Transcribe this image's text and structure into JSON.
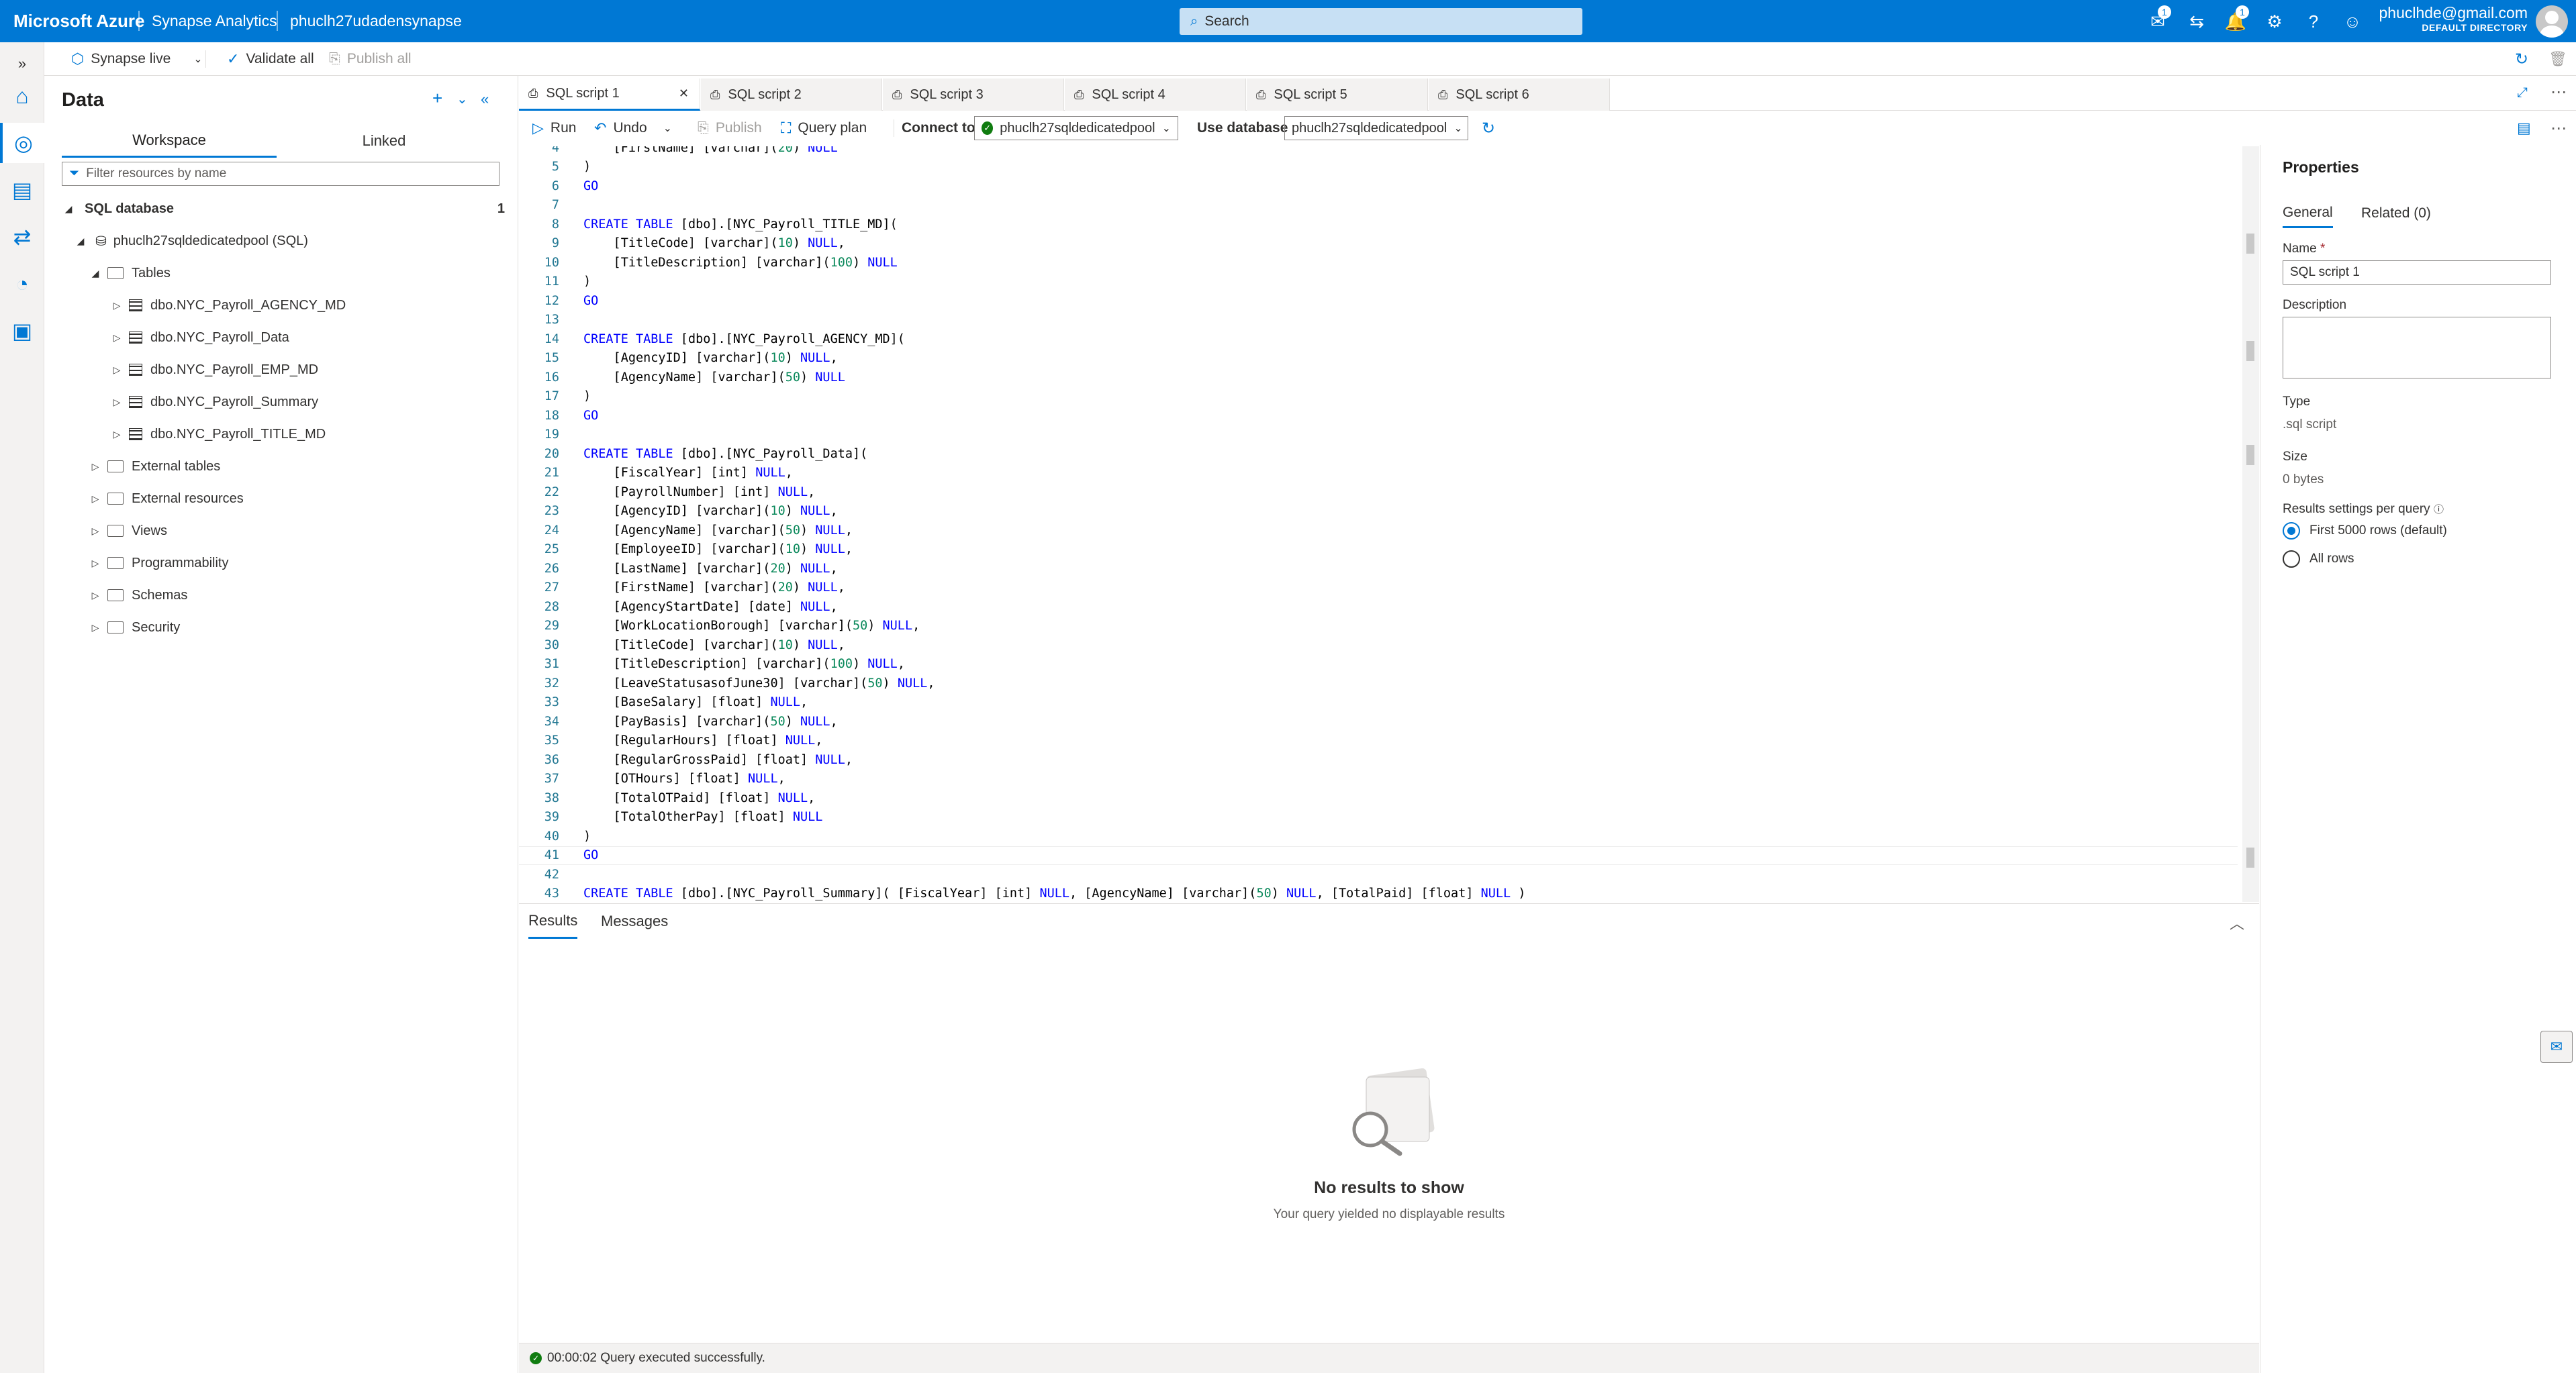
{
  "topbar": {
    "brand": "Microsoft Azure",
    "service": "Synapse Analytics",
    "workspace": "phuclh27udadensynapse",
    "search_placeholder": "Search",
    "badge_feedback": "1",
    "badge_notifications": "1",
    "user_email": "phuclhde@gmail.com",
    "directory": "DEFAULT DIRECTORY"
  },
  "commandbar": {
    "live_mode": "Synapse live",
    "validate_all": "Validate all",
    "publish_all": "Publish all"
  },
  "data_panel": {
    "title": "Data",
    "tab_workspace": "Workspace",
    "tab_linked": "Linked",
    "filter_placeholder": "Filter resources by name",
    "section": "SQL database",
    "section_count": "1",
    "pool": "phuclh27sqldedicatedpool (SQL)",
    "tables_label": "Tables",
    "tables": [
      "dbo.NYC_Payroll_AGENCY_MD",
      "dbo.NYC_Payroll_Data",
      "dbo.NYC_Payroll_EMP_MD",
      "dbo.NYC_Payroll_Summary",
      "dbo.NYC_Payroll_TITLE_MD"
    ],
    "folders": [
      "External tables",
      "External resources",
      "Views",
      "Programmability",
      "Schemas",
      "Security"
    ]
  },
  "editor_tabs": [
    "SQL script 1",
    "SQL script 2",
    "SQL script 3",
    "SQL script 4",
    "SQL script 5",
    "SQL script 6"
  ],
  "editor_toolbar": {
    "run": "Run",
    "undo": "Undo",
    "publish": "Publish",
    "query_plan": "Query plan",
    "connect_to_label": "Connect to",
    "connect_to_value": "phuclh27sqldedicatedpool",
    "use_database_label": "Use database",
    "use_database_value": "phuclh27sqldedicatedpool"
  },
  "code_lines": [
    {
      "n": "4",
      "t": "    [FirstName] [varchar](20) NULL"
    },
    {
      "n": "5",
      "t": ")"
    },
    {
      "n": "6",
      "t": "GO"
    },
    {
      "n": "7",
      "t": ""
    },
    {
      "n": "8",
      "t": "CREATE TABLE [dbo].[NYC_Payroll_TITLE_MD]("
    },
    {
      "n": "9",
      "t": "    [TitleCode] [varchar](10) NULL,"
    },
    {
      "n": "10",
      "t": "    [TitleDescription] [varchar](100) NULL"
    },
    {
      "n": "11",
      "t": ")"
    },
    {
      "n": "12",
      "t": "GO"
    },
    {
      "n": "13",
      "t": ""
    },
    {
      "n": "14",
      "t": "CREATE TABLE [dbo].[NYC_Payroll_AGENCY_MD]("
    },
    {
      "n": "15",
      "t": "    [AgencyID] [varchar](10) NULL,"
    },
    {
      "n": "16",
      "t": "    [AgencyName] [varchar](50) NULL"
    },
    {
      "n": "17",
      "t": ")"
    },
    {
      "n": "18",
      "t": "GO"
    },
    {
      "n": "19",
      "t": ""
    },
    {
      "n": "20",
      "t": "CREATE TABLE [dbo].[NYC_Payroll_Data]("
    },
    {
      "n": "21",
      "t": "    [FiscalYear] [int] NULL,"
    },
    {
      "n": "22",
      "t": "    [PayrollNumber] [int] NULL,"
    },
    {
      "n": "23",
      "t": "    [AgencyID] [varchar](10) NULL,"
    },
    {
      "n": "24",
      "t": "    [AgencyName] [varchar](50) NULL,"
    },
    {
      "n": "25",
      "t": "    [EmployeeID] [varchar](10) NULL,"
    },
    {
      "n": "26",
      "t": "    [LastName] [varchar](20) NULL,"
    },
    {
      "n": "27",
      "t": "    [FirstName] [varchar](20) NULL,"
    },
    {
      "n": "28",
      "t": "    [AgencyStartDate] [date] NULL,"
    },
    {
      "n": "29",
      "t": "    [WorkLocationBorough] [varchar](50) NULL,"
    },
    {
      "n": "30",
      "t": "    [TitleCode] [varchar](10) NULL,"
    },
    {
      "n": "31",
      "t": "    [TitleDescription] [varchar](100) NULL,"
    },
    {
      "n": "32",
      "t": "    [LeaveStatusasofJune30] [varchar](50) NULL,"
    },
    {
      "n": "33",
      "t": "    [BaseSalary] [float] NULL,"
    },
    {
      "n": "34",
      "t": "    [PayBasis] [varchar](50) NULL,"
    },
    {
      "n": "35",
      "t": "    [RegularHours] [float] NULL,"
    },
    {
      "n": "36",
      "t": "    [RegularGrossPaid] [float] NULL,"
    },
    {
      "n": "37",
      "t": "    [OTHours] [float] NULL,"
    },
    {
      "n": "38",
      "t": "    [TotalOTPaid] [float] NULL,"
    },
    {
      "n": "39",
      "t": "    [TotalOtherPay] [float] NULL"
    },
    {
      "n": "40",
      "t": ")"
    },
    {
      "n": "41",
      "t": "GO"
    },
    {
      "n": "42",
      "t": ""
    },
    {
      "n": "43",
      "t": "CREATE TABLE [dbo].[NYC_Payroll_Summary]( [FiscalYear] [int] NULL, [AgencyName] [varchar](50) NULL, [TotalPaid] [float] NULL )"
    }
  ],
  "results": {
    "tab_results": "Results",
    "tab_messages": "Messages",
    "empty_title": "No results to show",
    "empty_sub": "Your query yielded no displayable results",
    "status": "00:00:02 Query executed successfully."
  },
  "properties": {
    "title": "Properties",
    "tab_general": "General",
    "tab_related": "Related (0)",
    "name_label": "Name",
    "name_required": "*",
    "name_value": "SQL script 1",
    "description_label": "Description",
    "type_label": "Type",
    "type_value": ".sql script",
    "size_label": "Size",
    "size_value": "0 bytes",
    "results_settings_label": "Results settings per query",
    "option_first": "First 5000 rows (default)",
    "option_all": "All rows"
  },
  "colors": {
    "accent": "#0078d4",
    "keyword": "#0000ff",
    "number": "#09885a",
    "success": "#107c10"
  }
}
